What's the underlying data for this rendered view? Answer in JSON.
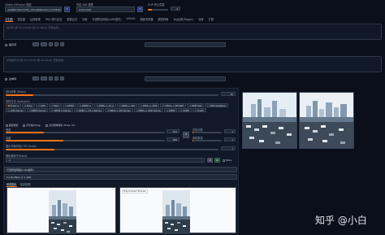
{
  "header": {
    "model_label": "Stable Diffusion 模型",
    "model_value": "realisticVisionV20_v20.safetensors [c0d1994c73]",
    "vae_label": "外挂 VAE 模型",
    "vae_value": "Automatic",
    "clip_label": "CLIP 终止层数",
    "clip_value": "2"
  },
  "tabs": [
    "文生图",
    "图生图",
    "后期处理",
    "PNG 图片信息",
    "模型合并",
    "训练",
    "可选附加网络(LoRA插件)",
    "Infinite",
    "图库浏览器",
    "模型转换",
    "Tag反推(Tagger)",
    "设置",
    "扩展"
  ],
  "prompt": {
    "placeholder": "提示词 (按 Ctrl+Enter 或 Alt+Enter 开始生成)"
  },
  "neg_prompt": {
    "placeholder": "反向提示词 (按 Ctrl+Enter 或 Alt+Enter 开始生成)"
  },
  "prompt_controls": [
    {
      "label": "提示词"
    },
    {
      "label": "反向词"
    }
  ],
  "params": {
    "steps_label": "迭代步数 (Steps)",
    "steps_value": "20",
    "sampler_label": "采样方法 (Sampler)",
    "samplers": [
      "Euler a",
      "Euler",
      "LMS",
      "Heun",
      "DPM2",
      "DPM2 a",
      "DPM++ 2S a",
      "DPM++ 2M",
      "DPM++ SDE",
      "DPM++ 2M SDE",
      "DPM fast",
      "DPM adaptive",
      "LMS Karras",
      "DPM2 Karras",
      "DPM2 a Karras",
      "DPM++ 2S a Karras",
      "DPM++ 2M Karras",
      "DPM++ SDE Karras",
      "DDIM",
      "PLMS",
      "UniPC"
    ],
    "sampler_selected": "Euler a",
    "restore_faces": "面部修复",
    "tiling": "可平铺(Tiling)",
    "hires": "高分辨率修复 (Hires. fix)",
    "width_label": "宽度",
    "width_value": "512",
    "height_label": "高度",
    "height_value": "768",
    "batch_count_label": "总批次数",
    "batch_count_value": "1",
    "batch_size_label": "单批数量",
    "batch_size_value": "1",
    "cfg_label": "提示词相关性(CFG Scale)",
    "cfg_value": "7",
    "seed_label": "随机数种子(Seed)",
    "seed_value": "-1",
    "extra_label": "Extra"
  },
  "lora_label": "可选附加网络(LoRA插件)",
  "controlnet": {
    "title": "ControlNet v1.1.186",
    "tab1": "单张图片",
    "tab2": "批量处理",
    "preview_label": "Preprocessor Preview"
  },
  "watermark": "知乎 @小白"
}
